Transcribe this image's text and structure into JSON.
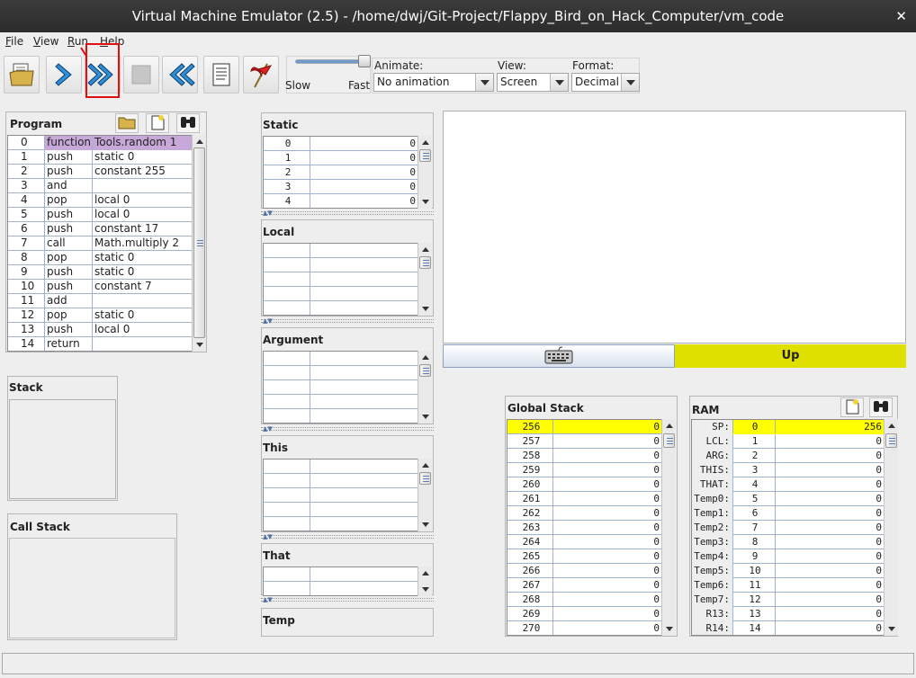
{
  "window": {
    "title": "Virtual Machine Emulator (2.5) - /home/dwj/Git-Project/Flappy_Bird_on_Hack_Computer/vm_code",
    "close": "✕"
  },
  "menu": [
    {
      "label": "File",
      "u": "F",
      "rest": "ile"
    },
    {
      "label": "View",
      "u": "V",
      "rest": "iew"
    },
    {
      "label": "Run",
      "u": "R",
      "rest": "un"
    },
    {
      "label": "Help",
      "u": "H",
      "rest": "elp"
    }
  ],
  "toolbar": {
    "speed_slow": "Slow",
    "speed_fast": "Fast",
    "speed_level": 1.0,
    "animate_label": "Animate:",
    "animate_value": "No animation",
    "view_label": "View:",
    "view_value": "Screen",
    "format_label": "Format:",
    "format_value": "Decimal"
  },
  "program": {
    "title": "Program",
    "rows": [
      [
        "0",
        "function",
        "Tools.random 1"
      ],
      [
        "1",
        "push",
        "static 0"
      ],
      [
        "2",
        "push",
        "constant 255"
      ],
      [
        "3",
        "and",
        ""
      ],
      [
        "4",
        "pop",
        "local 0"
      ],
      [
        "5",
        "push",
        "local 0"
      ],
      [
        "6",
        "push",
        "constant 17"
      ],
      [
        "7",
        "call",
        "Math.multiply 2"
      ],
      [
        "8",
        "pop",
        "static 0"
      ],
      [
        "9",
        "push",
        "static 0"
      ],
      [
        "10",
        "push",
        "constant 7"
      ],
      [
        "11",
        "add",
        ""
      ],
      [
        "12",
        "pop",
        "static 0"
      ],
      [
        "13",
        "push",
        "local 0"
      ],
      [
        "14",
        "return",
        ""
      ]
    ]
  },
  "stack": {
    "title": "Stack"
  },
  "call_stack": {
    "title": "Call Stack"
  },
  "segments": {
    "static": {
      "title": "Static",
      "rows": [
        [
          "0",
          "0"
        ],
        [
          "1",
          "0"
        ],
        [
          "2",
          "0"
        ],
        [
          "3",
          "0"
        ],
        [
          "4",
          "0"
        ]
      ]
    },
    "local": {
      "title": "Local"
    },
    "argument": {
      "title": "Argument"
    },
    "this": {
      "title": "This"
    },
    "that": {
      "title": "That"
    },
    "temp": {
      "title": "Temp"
    }
  },
  "keyboard": {
    "key_label": "Up",
    "highlight_color": "#e0e000"
  },
  "global_stack": {
    "title": "Global Stack",
    "rows": [
      [
        "256",
        "0"
      ],
      [
        "257",
        "0"
      ],
      [
        "258",
        "0"
      ],
      [
        "259",
        "0"
      ],
      [
        "260",
        "0"
      ],
      [
        "261",
        "0"
      ],
      [
        "262",
        "0"
      ],
      [
        "263",
        "0"
      ],
      [
        "264",
        "0"
      ],
      [
        "265",
        "0"
      ],
      [
        "266",
        "0"
      ],
      [
        "267",
        "0"
      ],
      [
        "268",
        "0"
      ],
      [
        "269",
        "0"
      ],
      [
        "270",
        "0"
      ]
    ]
  },
  "ram": {
    "title": "RAM",
    "rows": [
      [
        "SP:",
        "0",
        "256"
      ],
      [
        "LCL:",
        "1",
        "0"
      ],
      [
        "ARG:",
        "2",
        "0"
      ],
      [
        "THIS:",
        "3",
        "0"
      ],
      [
        "THAT:",
        "4",
        "0"
      ],
      [
        "Temp0:",
        "5",
        "0"
      ],
      [
        "Temp1:",
        "6",
        "0"
      ],
      [
        "Temp2:",
        "7",
        "0"
      ],
      [
        "Temp3:",
        "8",
        "0"
      ],
      [
        "Temp4:",
        "9",
        "0"
      ],
      [
        "Temp5:",
        "10",
        "0"
      ],
      [
        "Temp6:",
        "11",
        "0"
      ],
      [
        "Temp7:",
        "12",
        "0"
      ],
      [
        "R13:",
        "13",
        "0"
      ],
      [
        "R14:",
        "14",
        "0"
      ]
    ]
  },
  "colors": {
    "row_highlight": "#ffff00",
    "program_highlight": "#c7a8d8",
    "red_annotation": "#e01010"
  }
}
